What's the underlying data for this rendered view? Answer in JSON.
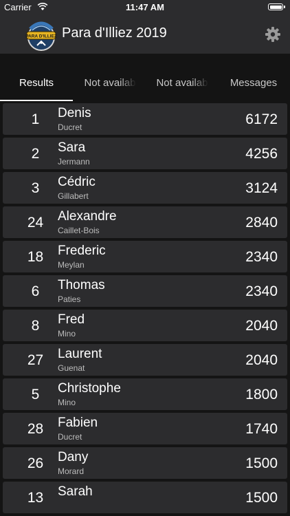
{
  "status_bar": {
    "carrier": "Carrier",
    "time": "11:47 AM",
    "battery_level": 1.0
  },
  "header": {
    "title": "Para d'Illiez 2019",
    "logo_text": "PARA D'ILLIEZ",
    "settings_icon": "gear-icon"
  },
  "tabs": [
    {
      "label": "Results",
      "active": true
    },
    {
      "label": "Not availab",
      "active": false
    },
    {
      "label": "Not availab",
      "active": false
    },
    {
      "label": "Messages",
      "active": false
    }
  ],
  "results": [
    {
      "rank": "1",
      "first_name": "Denis",
      "last_name": "Ducret",
      "score": "6172"
    },
    {
      "rank": "2",
      "first_name": "Sara",
      "last_name": "Jermann",
      "score": "4256"
    },
    {
      "rank": "3",
      "first_name": "Cédric",
      "last_name": "Gillabert",
      "score": "3124"
    },
    {
      "rank": "24",
      "first_name": "Alexandre",
      "last_name": "Caillet-Bois",
      "score": "2840"
    },
    {
      "rank": "18",
      "first_name": "Frederic",
      "last_name": "Meylan",
      "score": "2340"
    },
    {
      "rank": "6",
      "first_name": "Thomas",
      "last_name": "Paties",
      "score": "2340"
    },
    {
      "rank": "8",
      "first_name": "Fred",
      "last_name": "Mino",
      "score": "2040"
    },
    {
      "rank": "27",
      "first_name": "Laurent",
      "last_name": "Guenat",
      "score": "2040"
    },
    {
      "rank": "5",
      "first_name": "Christophe",
      "last_name": "Mino",
      "score": "1800"
    },
    {
      "rank": "28",
      "first_name": "Fabien",
      "last_name": "Ducret",
      "score": "1740"
    },
    {
      "rank": "26",
      "first_name": "Dany",
      "last_name": "Morard",
      "score": "1500"
    },
    {
      "rank": "13",
      "first_name": "Sarah",
      "last_name": "",
      "score": "1500"
    }
  ]
}
